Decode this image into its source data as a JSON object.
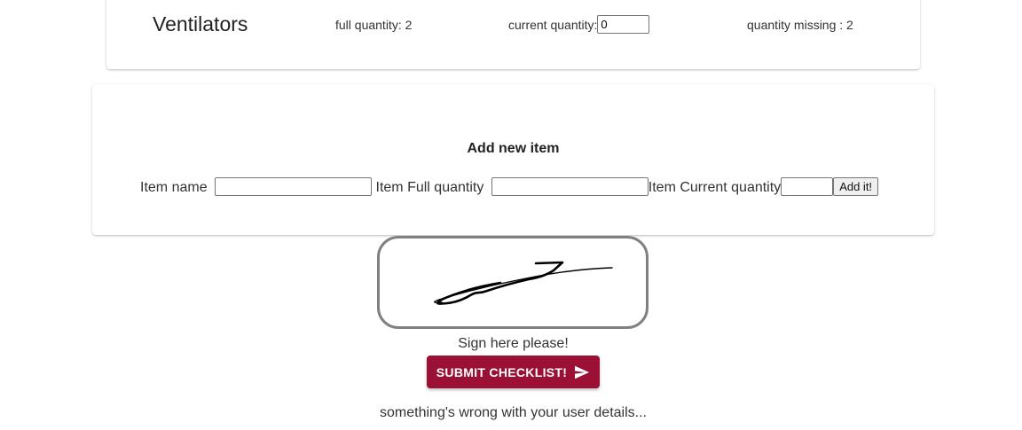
{
  "item": {
    "name": "Ventilators",
    "full_quantity_text": "full quantity: 2",
    "current_quantity_label": "current quantity:",
    "current_quantity_value": "0",
    "missing_quantity_text": "quantity missing : 2"
  },
  "add_item": {
    "title": "Add new item",
    "name_label": "Item name",
    "name_value": "",
    "full_quantity_label": "Item Full quantity",
    "full_quantity_value": "",
    "current_quantity_label": "Item Current quantity",
    "current_quantity_value": "",
    "add_button_label": "Add it!"
  },
  "signature": {
    "label": "Sign here please!"
  },
  "submit": {
    "label": "SUBMIT CHECKLIST!",
    "icon": "send-icon",
    "color": "#9b1035"
  },
  "status": {
    "message": "something's wrong with your user details..."
  }
}
